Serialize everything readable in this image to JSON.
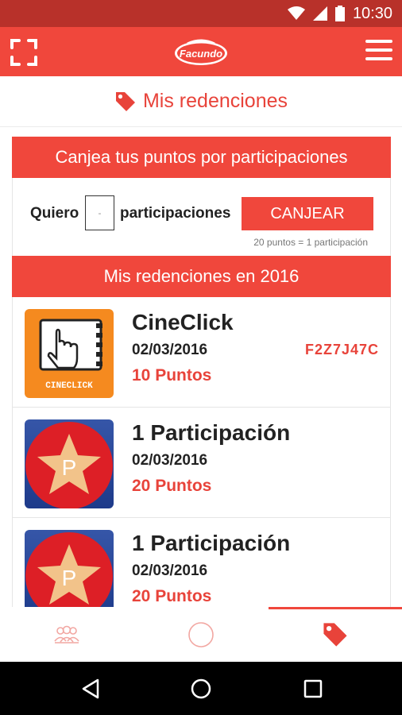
{
  "status_bar": {
    "time": "10:30"
  },
  "app_bar": {
    "logo_text": "Facundo"
  },
  "page": {
    "title": "Mis redenciones"
  },
  "redeem": {
    "header": "Canjea tus puntos por participaciones",
    "quiero_label": "Quiero",
    "qty_value": "-",
    "participaciones_label": "participaciones",
    "button_label": "CANJEAR",
    "conversion_note": "20 puntos = 1 participación"
  },
  "history": {
    "header": "Mis redenciones en 2016",
    "items": [
      {
        "title": "CineClick",
        "date": "02/03/2016",
        "points": "10 Puntos",
        "code": "F2Z7J47C",
        "thumb_label": "CINECLICK",
        "icon": "cineclick-logo"
      },
      {
        "title": "1 Participación",
        "date": "02/03/2016",
        "points": "20 Puntos",
        "code": "",
        "thumb_label": "P",
        "icon": "participation-star-icon"
      },
      {
        "title": "1 Participación",
        "date": "02/03/2016",
        "points": "20 Puntos",
        "code": "",
        "thumb_label": "P",
        "icon": "participation-star-icon"
      }
    ]
  },
  "bottom_nav": {
    "items": [
      {
        "icon": "community-icon",
        "active": false
      },
      {
        "icon": "circle-icon",
        "active": false
      },
      {
        "icon": "tag-icon",
        "active": true
      }
    ]
  },
  "colors": {
    "primary": "#f0473c",
    "status_bar": "#b8312a",
    "text": "#222222"
  }
}
